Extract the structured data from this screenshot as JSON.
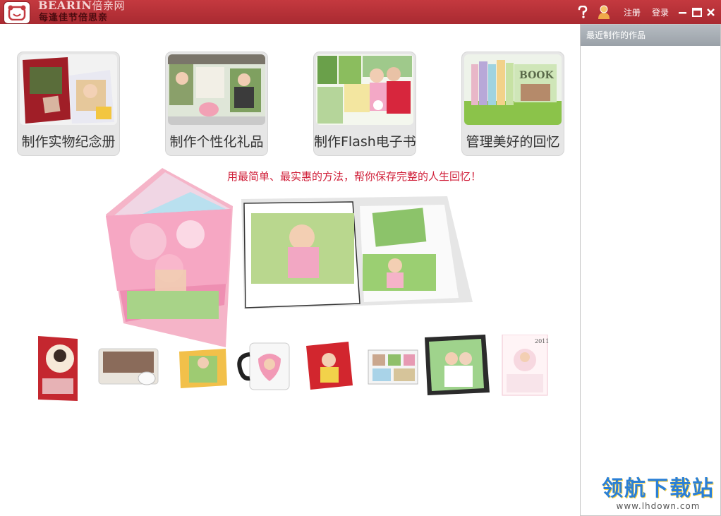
{
  "app": {
    "brand_name": "BEARIN",
    "brand_cn": "倍亲网",
    "slogan": "每逢佳节倍思亲"
  },
  "titlebar": {
    "help_icon": "question-icon",
    "user_icon": "person-icon",
    "register_label": "注册",
    "login_label": "登录"
  },
  "categories": [
    {
      "label": "制作实物纪念册",
      "icon": "photo-album-icon"
    },
    {
      "label": "制作个性化礼品",
      "icon": "gift-icon"
    },
    {
      "label": "制作Flash电子书",
      "icon": "flash-book-icon"
    },
    {
      "label": "管理美好的回忆",
      "icon": "books-icon"
    }
  ],
  "banner": {
    "tagline": "用最简单、最实惠的方法，帮你保存完整的人生回忆！",
    "book_word": "BOOK",
    "calendar_year": "2011"
  },
  "sidebar": {
    "title": "最近制作的作品"
  },
  "watermark": {
    "title": "领航下载站",
    "url": "www.lhdown.com"
  },
  "colors": {
    "titlebar": "#b3313a",
    "accent_red": "#d0203a",
    "sidebar_header": "#a9afb5"
  }
}
